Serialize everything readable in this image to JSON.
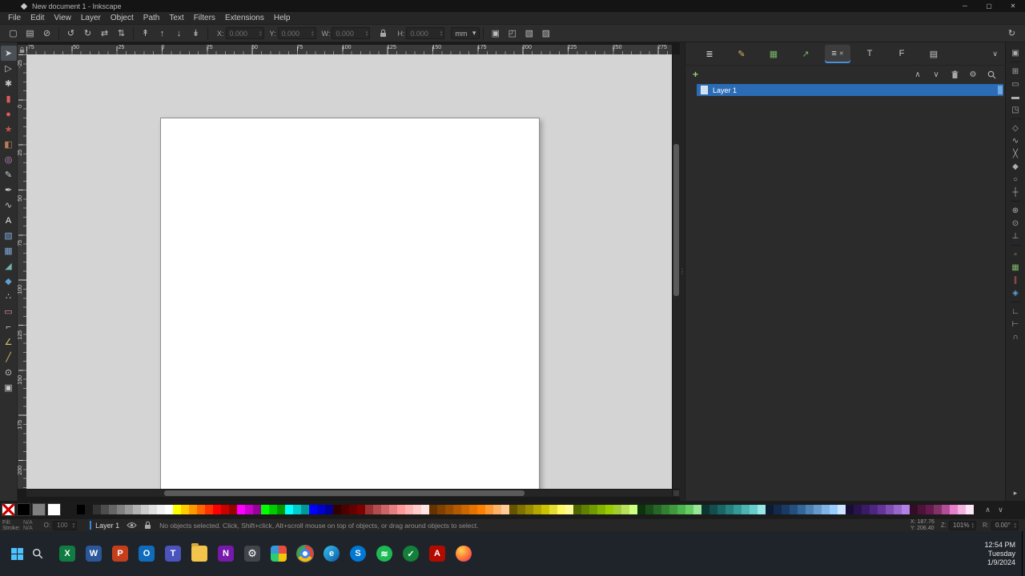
{
  "window": {
    "title": "New document 1 - Inkscape"
  },
  "icons": {
    "minimize": "─",
    "maximize": "▢",
    "close": "✕",
    "chevron_up": "∧",
    "chevron_down": "∨",
    "chevron_right": "▸",
    "dropdown": "▾",
    "spin_up": "▴",
    "spin_down": "▾",
    "dots": "⋮",
    "plus": "+",
    "gear": "⚙",
    "lock_ratio": "∞"
  },
  "menu": {
    "items": [
      "File",
      "Edit",
      "View",
      "Layer",
      "Object",
      "Path",
      "Text",
      "Filters",
      "Extensions",
      "Help"
    ]
  },
  "tool_controls": {
    "groups": [
      [
        {
          "name": "select-all-icon",
          "glyph": "▢"
        },
        {
          "name": "select-all-layers-icon",
          "glyph": "▤"
        },
        {
          "name": "deselect-icon",
          "glyph": "⊘"
        }
      ],
      [
        {
          "name": "rotate-ccw-icon",
          "glyph": "↺"
        },
        {
          "name": "rotate-cw-icon",
          "glyph": "↻"
        },
        {
          "name": "flip-horizontal-icon",
          "glyph": "⇄"
        },
        {
          "name": "flip-vertical-icon",
          "glyph": "⇅"
        }
      ],
      [
        {
          "name": "raise-to-top-icon",
          "glyph": "↟"
        },
        {
          "name": "raise-icon",
          "glyph": "↑"
        },
        {
          "name": "lower-icon",
          "glyph": "↓"
        },
        {
          "name": "lower-to-bottom-icon",
          "glyph": "↡"
        }
      ]
    ],
    "x_label": "X:",
    "x_value": "0.000",
    "y_label": "Y:",
    "y_value": "0.000",
    "w_label": "W:",
    "w_value": "0.000",
    "h_label": "H:",
    "h_value": "0.000",
    "unit": "mm",
    "toggles": [
      {
        "name": "scale-stroke-toggle-icon",
        "glyph": "▣"
      },
      {
        "name": "scale-corners-toggle-icon",
        "glyph": "◰"
      },
      {
        "name": "scale-gradients-toggle-icon",
        "glyph": "▧"
      },
      {
        "name": "scale-patterns-toggle-icon",
        "glyph": "▨"
      }
    ]
  },
  "toolbox": [
    {
      "name": "selector-tool",
      "glyph": "➤",
      "color": "#d6d6d6"
    },
    {
      "name": "node-tool",
      "glyph": "▷",
      "color": "#c9c9c9"
    },
    {
      "name": "tweak-tool",
      "glyph": "✱",
      "color": "#c9c9c9"
    },
    {
      "name": "rectangle-tool",
      "glyph": "▮",
      "color": "#e05c5c"
    },
    {
      "name": "ellipse-tool",
      "glyph": "●",
      "color": "#e05c5c"
    },
    {
      "name": "star-tool",
      "glyph": "★",
      "color": "#c4574e"
    },
    {
      "name": "box-3d-tool",
      "glyph": "◧",
      "color": "#b58056"
    },
    {
      "name": "spiral-tool",
      "glyph": "◎",
      "color": "#c98ccb"
    },
    {
      "name": "pencil-tool",
      "glyph": "✎",
      "color": "#cccccc"
    },
    {
      "name": "pen-tool",
      "glyph": "✒",
      "color": "#cccccc"
    },
    {
      "name": "calligraphy-tool",
      "glyph": "∿",
      "color": "#cccccc"
    },
    {
      "name": "text-tool",
      "glyph": "A",
      "color": "#e8e8e8"
    },
    {
      "name": "gradient-tool",
      "glyph": "▧",
      "color": "#7aa7d6"
    },
    {
      "name": "mesh-tool",
      "glyph": "▦",
      "color": "#7aa7d6"
    },
    {
      "name": "dropper-tool",
      "glyph": "◢",
      "color": "#6fb3b0"
    },
    {
      "name": "bucket-tool",
      "glyph": "◆",
      "color": "#5e9fd4"
    },
    {
      "name": "spray-tool",
      "glyph": "∴",
      "color": "#cccccc"
    },
    {
      "name": "eraser-tool",
      "glyph": "▭",
      "color": "#e091b5"
    },
    {
      "name": "connector-tool",
      "glyph": "⌐",
      "color": "#cccccc"
    },
    {
      "name": "lpe-tool",
      "glyph": "∠",
      "color": "#d6c769"
    },
    {
      "name": "measure-tool",
      "glyph": "╱",
      "color": "#d6c769"
    },
    {
      "name": "zoom-tool",
      "glyph": "⊙",
      "color": "#cccccc"
    },
    {
      "name": "pages-tool",
      "glyph": "▣",
      "color": "#cccccc"
    }
  ],
  "rulers": {
    "h_labels": [
      "-75",
      "-50",
      "-25",
      "0",
      "25",
      "50",
      "75",
      "100",
      "125",
      "150",
      "175",
      "200",
      "225",
      "250",
      "275"
    ],
    "v_labels": [
      "-25",
      "0",
      "25",
      "50",
      "75",
      "100",
      "125",
      "150",
      "175",
      "200"
    ]
  },
  "dialog_tabs": [
    {
      "name": "tab-align-distribute",
      "glyph": "≣",
      "color": "#c8c8c8"
    },
    {
      "name": "tab-fill-stroke",
      "glyph": "✎",
      "color": "#d9b85c"
    },
    {
      "name": "tab-export",
      "glyph": "▦",
      "color": "#79b465"
    },
    {
      "name": "tab-objects",
      "glyph": "↗",
      "color": "#79b465"
    },
    {
      "name": "tab-layers",
      "glyph": "≡",
      "color": "#e0e0e0",
      "active": true
    },
    {
      "name": "tab-text",
      "glyph": "T",
      "color": "#c8c8c8"
    },
    {
      "name": "tab-font-collections",
      "glyph": "F",
      "color": "#c8c8c8"
    },
    {
      "name": "tab-symbols",
      "glyph": "▤",
      "color": "#c8c8c8"
    }
  ],
  "layers_panel": {
    "layer_name": "Layer 1"
  },
  "snap_bar": [
    {
      "name": "display-mode-icon",
      "glyph": "▣"
    },
    {
      "sep": true
    },
    {
      "name": "snapping-toggle-icon",
      "glyph": "⊞"
    },
    {
      "name": "snap-bbox-icon",
      "glyph": "▭"
    },
    {
      "name": "snap-bbox-edges-icon",
      "glyph": "▬"
    },
    {
      "name": "snap-bbox-corners-icon",
      "glyph": "◳"
    },
    {
      "sep": true
    },
    {
      "name": "snap-nodes-icon",
      "glyph": "◇"
    },
    {
      "name": "snap-path-icon",
      "glyph": "∿"
    },
    {
      "name": "snap-intersections-icon",
      "glyph": "╳"
    },
    {
      "name": "snap-cusp-nodes-icon",
      "glyph": "◆"
    },
    {
      "name": "snap-smooth-nodes-icon",
      "glyph": "○"
    },
    {
      "name": "snap-midpoints-icon",
      "glyph": "┼"
    },
    {
      "sep": true
    },
    {
      "name": "snap-object-centers-icon",
      "glyph": "⊕"
    },
    {
      "name": "snap-rotation-centers-icon",
      "glyph": "⊙"
    },
    {
      "name": "snap-text-baselines-icon",
      "glyph": "⊥"
    },
    {
      "sep": true
    },
    {
      "name": "snap-page-border-icon",
      "glyph": "▫",
      "color": "#7cb868"
    },
    {
      "name": "snap-grid-icon",
      "glyph": "▦",
      "color": "#7cb868"
    },
    {
      "name": "snap-guides-icon",
      "glyph": "∥",
      "color": "#c85b5b"
    },
    {
      "name": "snap-alignment-icon",
      "glyph": "◈",
      "color": "#5e9fd4"
    },
    {
      "sep": true
    },
    {
      "name": "snap-distribution-icon",
      "glyph": "∟"
    },
    {
      "name": "snap-perpendicular-icon",
      "glyph": "⊢"
    },
    {
      "name": "snap-tangential-icon",
      "glyph": "∩"
    }
  ],
  "palette": {
    "colors": [
      "#000000",
      "#1a1a1a",
      "#333333",
      "#4d4d4d",
      "#666666",
      "#808080",
      "#999999",
      "#b3b3b3",
      "#cccccc",
      "#e0e0e0",
      "#f2f2f2",
      "#ffffff",
      "#ffff00",
      "#ffcc00",
      "#ff9900",
      "#ff6600",
      "#ff3300",
      "#ff0000",
      "#cc0000",
      "#990000",
      "#ff00ff",
      "#cc00cc",
      "#990099",
      "#00ff00",
      "#00cc00",
      "#009900",
      "#00ffff",
      "#00cccc",
      "#009999",
      "#0000ff",
      "#0000cc",
      "#000099",
      "#330000",
      "#4d0000",
      "#660000",
      "#800000",
      "#993333",
      "#b34d4d",
      "#cc6666",
      "#e68080",
      "#ff9999",
      "#ffb3b3",
      "#ffcccc",
      "#ffe6e6",
      "#663300",
      "#804000",
      "#994d00",
      "#b35900",
      "#cc6600",
      "#e67300",
      "#ff8000",
      "#ff9933",
      "#ffb366",
      "#ffcc99",
      "#665500",
      "#807100",
      "#998c00",
      "#b3a700",
      "#ccc200",
      "#e6dd33",
      "#fff766",
      "#fffa99",
      "#4d6600",
      "#608000",
      "#739900",
      "#86b300",
      "#99cc00",
      "#a3cc33",
      "#b8e05c",
      "#ccff80",
      "#0d330d",
      "#1a4d1a",
      "#266626",
      "#338033",
      "#409940",
      "#4db34d",
      "#66cc66",
      "#99e699",
      "#0d3333",
      "#134d4d",
      "#1a6666",
      "#268080",
      "#339999",
      "#4db3b3",
      "#66cccc",
      "#99e6e6",
      "#0d1a33",
      "#132a4d",
      "#1a3a66",
      "#264d80",
      "#336699",
      "#4d80b3",
      "#6699cc",
      "#80b3e6",
      "#99ccff",
      "#cce6ff",
      "#1a0d33",
      "#2a134d",
      "#3a1a66",
      "#4d2680",
      "#663399",
      "#804db3",
      "#9966cc",
      "#b380e6",
      "#330d26",
      "#4d1339",
      "#661a4d",
      "#803366",
      "#b34d99",
      "#e680cc",
      "#f2b3e0",
      "#ffe6f7"
    ]
  },
  "status_bar": {
    "fill_label": "Fill:",
    "fill_value": "N/A",
    "stroke_label": "Stroke:",
    "stroke_value": "N/A",
    "opacity_label": "O:",
    "opacity_value": "100",
    "layer_name": "Layer 1",
    "message": "No objects selected. Click, Shift+click, Alt+scroll mouse on top of objects, or drag around objects to select.",
    "x_label": "X:",
    "x_value": "187.76",
    "y_label": "Y:",
    "y_value": "206.40",
    "zoom_label": "Z:",
    "zoom_value": "101%",
    "rotation_label": "R:",
    "rotation_value": "0.00°"
  },
  "taskbar": {
    "time": "12:54 PM",
    "day": "Tuesday",
    "date": "1/9/2024",
    "apps": [
      {
        "name": "excel-icon",
        "type": "square",
        "label": "X",
        "bg": "#107c41"
      },
      {
        "name": "word-icon",
        "type": "square",
        "label": "W",
        "bg": "#2b579a"
      },
      {
        "name": "powerpoint-icon",
        "type": "square",
        "label": "P",
        "bg": "#c43e1c"
      },
      {
        "name": "outlook-icon",
        "type": "square",
        "label": "O",
        "bg": "#0f6cbd"
      },
      {
        "name": "teams-icon",
        "type": "square",
        "label": "T",
        "bg": "#4b53bc"
      },
      {
        "name": "file-explorer-icon",
        "type": "folder",
        "label": "",
        "bg": "#f3c64b"
      },
      {
        "name": "onenote-icon",
        "type": "square",
        "label": "N",
        "bg": "#7719aa"
      },
      {
        "name": "settings-icon",
        "type": "gear",
        "label": "⚙",
        "bg": "#41464d"
      },
      {
        "name": "photos-icon",
        "type": "photos",
        "label": "",
        "bg": ""
      },
      {
        "name": "chrome-icon",
        "type": "chrome",
        "label": "",
        "bg": "",
        "active": true
      },
      {
        "name": "edge-icon",
        "type": "circle",
        "label": "e",
        "bg": "linear-gradient(135deg,#35c1f1,#0c59a4)"
      },
      {
        "name": "skype-icon",
        "type": "circle",
        "label": "S",
        "bg": "#0078d4"
      },
      {
        "name": "spotify-icon",
        "type": "circle",
        "label": "≋",
        "bg": "#1db954"
      },
      {
        "name": "todo-app-icon",
        "type": "circle",
        "label": "✓",
        "bg": "#13813c"
      },
      {
        "name": "acrobat-icon",
        "type": "square",
        "label": "A",
        "bg": "#b30b00"
      },
      {
        "name": "firefox-icon",
        "type": "circle",
        "label": "",
        "bg": "radial-gradient(circle at 35% 30%,#ffd54f,#ff7139 55%,#e1376b 90%)"
      }
    ]
  }
}
